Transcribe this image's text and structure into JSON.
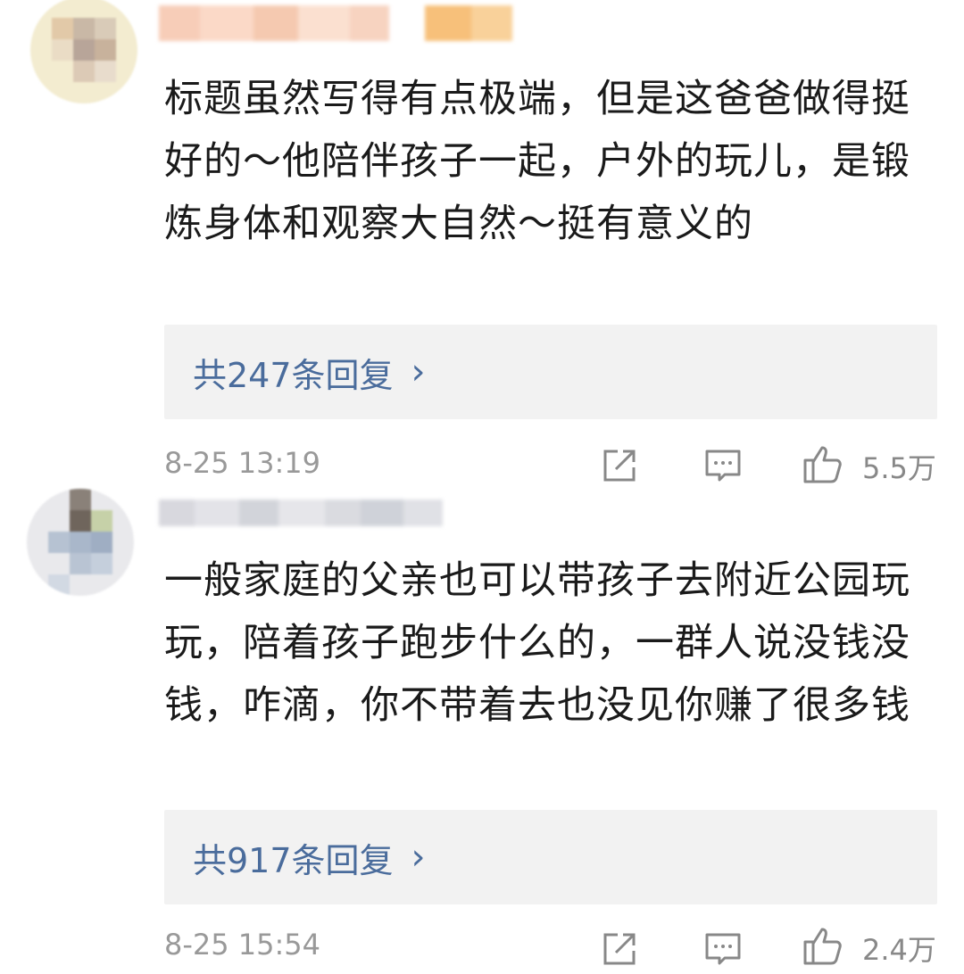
{
  "comments": [
    {
      "text": "标题虽然写得有点极端，但是这爸爸做得挺好的～他陪伴孩子一起，户外的玩儿，是锻炼身体和观察大自然～挺有意义的",
      "replies_label": "共247条回复",
      "time": "8-25 13:19",
      "likes": "5.5万"
    },
    {
      "text": "一般家庭的父亲也可以带孩子去附近公园玩玩，陪着孩子跑步什么的，一群人说没钱没钱，咋滴，你不带着去也没见你赚了很多钱",
      "replies_label": "共917条回复",
      "time": "8-25 15:54",
      "likes": "2.4万"
    }
  ],
  "icons": {
    "share": "share-icon",
    "comment": "comment-icon",
    "like": "thumbs-up-icon",
    "chevron": "chevron-right-icon"
  },
  "colors": {
    "reply_link": "#4a6c9c",
    "meta_gray": "#999999",
    "reply_bg": "#f2f2f2"
  }
}
